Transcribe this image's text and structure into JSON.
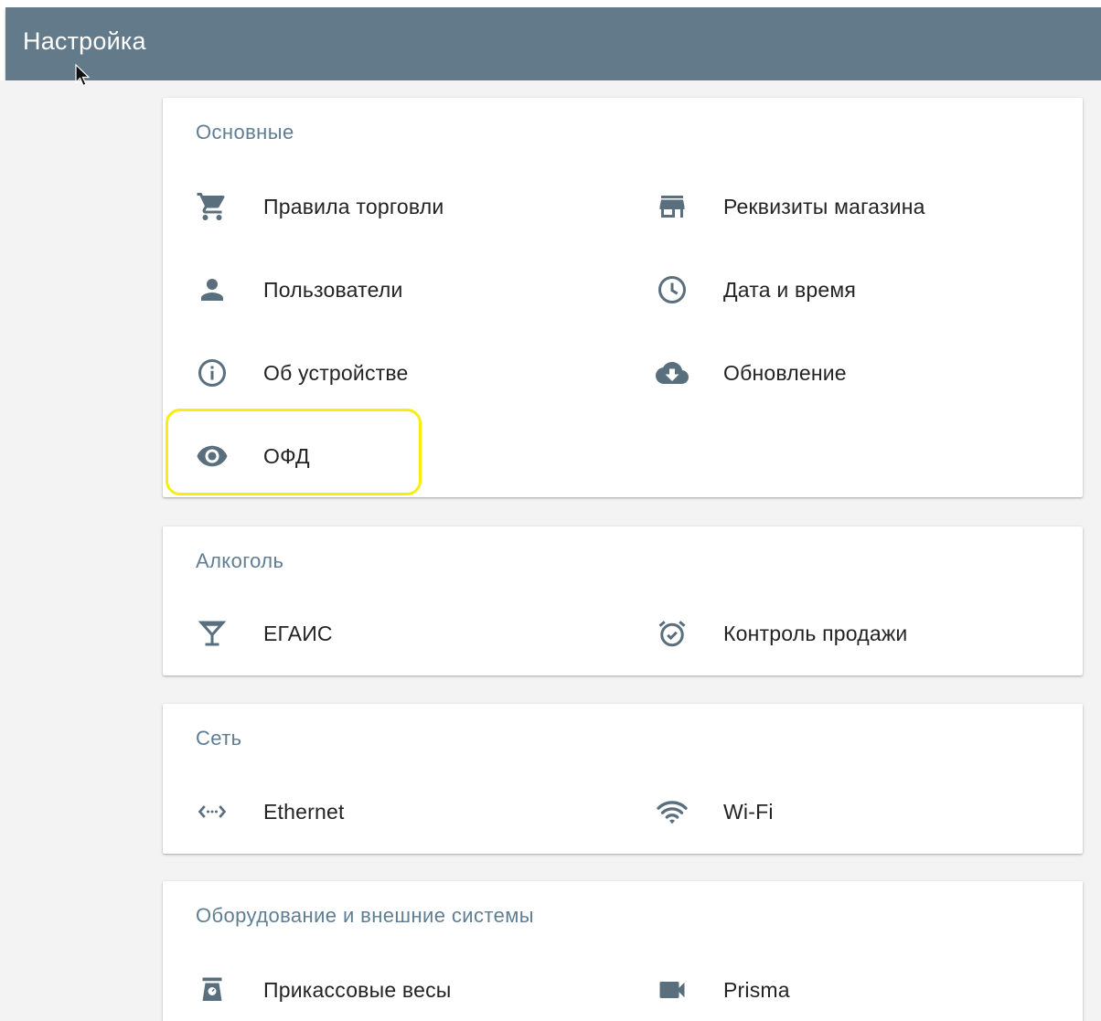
{
  "header": {
    "title": "Настройка"
  },
  "sections": {
    "main": {
      "title": "Основные",
      "items": [
        {
          "label": "Правила торговли",
          "icon": "cart-icon"
        },
        {
          "label": "Реквизиты магазина",
          "icon": "store-icon"
        },
        {
          "label": "Пользователи",
          "icon": "person-icon"
        },
        {
          "label": "Дата и время",
          "icon": "clock-icon"
        },
        {
          "label": "Об устройстве",
          "icon": "info-icon"
        },
        {
          "label": "Обновление",
          "icon": "cloud-download-icon"
        },
        {
          "label": "ОФД",
          "icon": "eye-icon"
        }
      ]
    },
    "alcohol": {
      "title": "Алкоголь",
      "items": [
        {
          "label": "ЕГАИС",
          "icon": "glass-icon"
        },
        {
          "label": "Контроль продажи",
          "icon": "alarm-icon"
        }
      ]
    },
    "network": {
      "title": "Сеть",
      "items": [
        {
          "label": "Ethernet",
          "icon": "ethernet-icon"
        },
        {
          "label": "Wi-Fi",
          "icon": "wifi-icon"
        }
      ]
    },
    "hardware": {
      "title": "Оборудование и внешние системы",
      "items": [
        {
          "label": "Прикассовые весы",
          "icon": "scale-icon"
        },
        {
          "label": "Prisma",
          "icon": "videocam-icon"
        }
      ]
    }
  },
  "colors": {
    "header_bg": "#627a8a",
    "section_title": "#5f7e93",
    "icon": "#5a6f7e",
    "highlight": "#f5ee0e"
  }
}
